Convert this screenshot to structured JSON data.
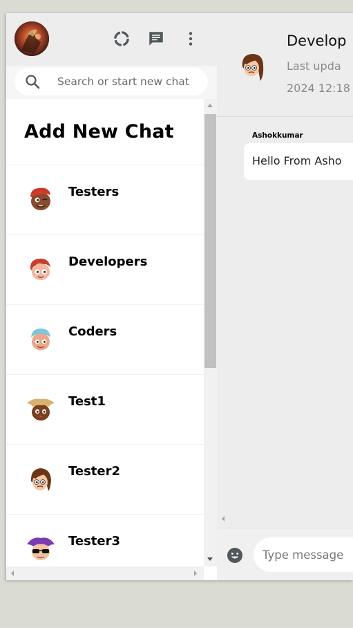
{
  "sidebar": {
    "search": {
      "placeholder": "Search or start new chat"
    },
    "add_new_chat_label": "Add New Chat",
    "rooms": [
      {
        "name": "Testers",
        "avatar": "avatar-testers"
      },
      {
        "name": "Developers",
        "avatar": "avatar-developers"
      },
      {
        "name": "Coders",
        "avatar": "avatar-coders"
      },
      {
        "name": "Test1",
        "avatar": "avatar-test1"
      },
      {
        "name": "Tester2",
        "avatar": "avatar-tester2"
      },
      {
        "name": "Tester3",
        "avatar": "avatar-tester3"
      }
    ],
    "header_icons": [
      "refresh-icon",
      "chat-icon",
      "more-vert-icon"
    ]
  },
  "chat": {
    "title": "Develop",
    "subtitle_line1": "Last upda",
    "subtitle_line2": "2024 12:18",
    "messages": [
      {
        "sender": "Ashokkumar",
        "text": "Hello From Asho"
      }
    ],
    "input": {
      "placeholder": "Type message"
    }
  },
  "colors": {
    "background": "#dadbd3",
    "header": "#ededed",
    "panel": "#ffffff",
    "icon": "#51585c"
  }
}
